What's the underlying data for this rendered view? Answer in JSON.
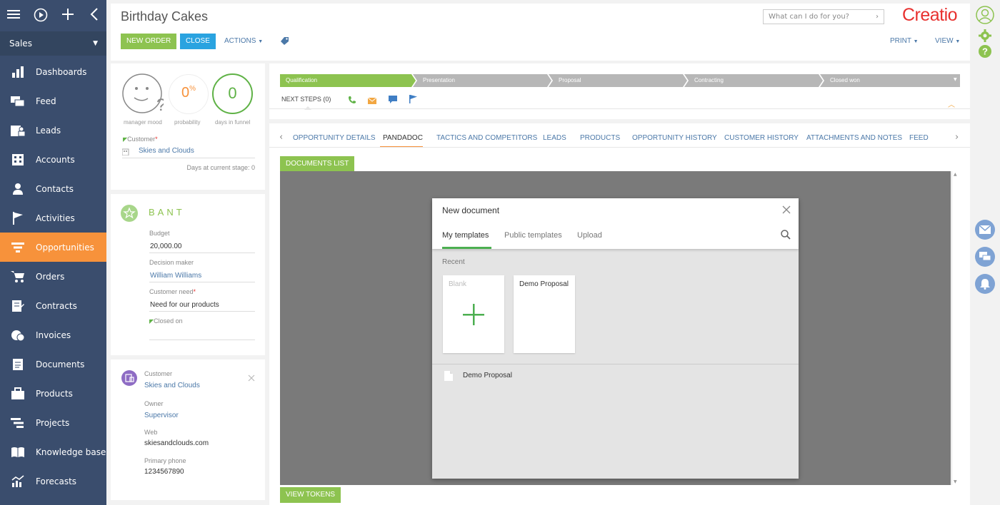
{
  "nav": {
    "workplace": "Sales",
    "items": [
      {
        "label": "Dashboards",
        "icon": "dashboards-icon"
      },
      {
        "label": "Feed",
        "icon": "feed-icon"
      },
      {
        "label": "Leads",
        "icon": "leads-icon"
      },
      {
        "label": "Accounts",
        "icon": "accounts-icon"
      },
      {
        "label": "Contacts",
        "icon": "contacts-icon"
      },
      {
        "label": "Activities",
        "icon": "activities-icon"
      },
      {
        "label": "Opportunities",
        "icon": "opportunities-icon",
        "active": true
      },
      {
        "label": "Orders",
        "icon": "orders-icon"
      },
      {
        "label": "Contracts",
        "icon": "contracts-icon"
      },
      {
        "label": "Invoices",
        "icon": "invoices-icon"
      },
      {
        "label": "Documents",
        "icon": "documents-icon"
      },
      {
        "label": "Products",
        "icon": "products-icon"
      },
      {
        "label": "Projects",
        "icon": "projects-icon"
      },
      {
        "label": "Knowledge base",
        "icon": "knowledge-base-icon"
      },
      {
        "label": "Forecasts",
        "icon": "forecasts-icon"
      }
    ]
  },
  "header": {
    "title": "Birthday Cakes",
    "new_order": "NEW ORDER",
    "close": "CLOSE",
    "actions": "ACTIONS",
    "print": "PRINT",
    "view": "VIEW",
    "search_placeholder": "What can I do for you?",
    "logo": "Creatio"
  },
  "summary": {
    "mood_label": "manager mood",
    "probability_value": "0",
    "probability_unit": "%",
    "probability_label": "probability",
    "days_value": "0",
    "days_label": "days in funnel",
    "customer_label": "Customer",
    "customer_value": "Skies and Clouds",
    "days_stage": "Days at current stage:  0"
  },
  "bant": {
    "title": "BANT",
    "budget_label": "Budget",
    "budget_value": "20,000.00",
    "decision_label": "Decision maker",
    "decision_value": "William Williams",
    "need_label": "Customer need",
    "need_value": "Need for our products",
    "closed_label": "Closed on"
  },
  "contact": {
    "customer_label": "Customer",
    "customer_value": "Skies and Clouds",
    "owner_label": "Owner",
    "owner_value": "Supervisor",
    "web_label": "Web",
    "web_value": "skiesandclouds.com",
    "phone_label": "Primary phone",
    "phone_value": "1234567890"
  },
  "stages": [
    "Qualification",
    "Presentation",
    "Proposal",
    "Contracting",
    "Closed won"
  ],
  "next_steps": "NEXT STEPS (0)",
  "tabs": [
    "OPPORTUNITY DETAILS",
    "PANDADOC",
    "TACTICS AND COMPETITORS",
    "LEADS",
    "PRODUCTS",
    "OPPORTUNITY HISTORY",
    "CUSTOMER HISTORY",
    "ATTACHMENTS AND NOTES",
    "FEED"
  ],
  "documents_list": "DOCUMENTS LIST",
  "view_tokens": "VIEW TOKENS",
  "dialog": {
    "title": "New document",
    "tabs": [
      "My templates",
      "Public templates",
      "Upload"
    ],
    "recent": "Recent",
    "blank": "Blank",
    "demo_card": "Demo Proposal",
    "demo_row": "Demo Proposal"
  },
  "colors": {
    "nav_bg": "#3a4d6d",
    "nav_active": "#f7923b",
    "accent_green": "#8dc350",
    "accent_blue": "#2aa3e0",
    "logo_red": "#e8312f",
    "link": "#4b78a8"
  }
}
